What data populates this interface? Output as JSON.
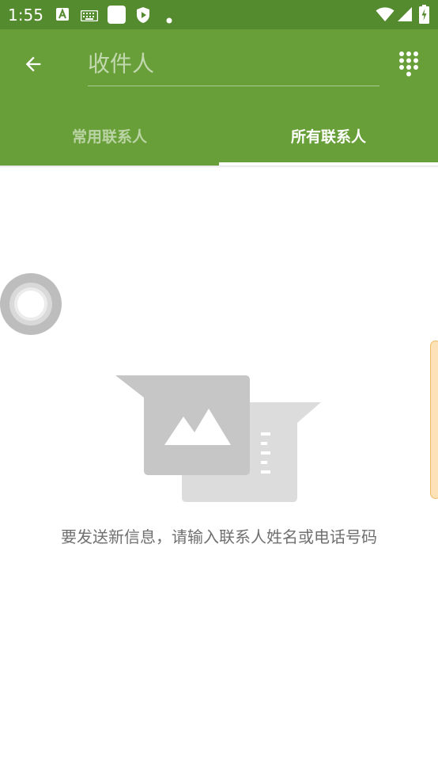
{
  "status_bar": {
    "time": "1:55",
    "icons": [
      "a-notification-icon",
      "keyboard-icon",
      "square-notification-icon",
      "shield-play-icon",
      "dot-icon",
      "wifi-icon",
      "signal-icon",
      "battery-charging-icon"
    ]
  },
  "app_bar": {
    "back_icon": "arrow-back-icon",
    "recipient_placeholder": "收件人",
    "dialpad_icon": "dialpad-icon",
    "tabs": [
      {
        "label": "常用联系人",
        "selected": false
      },
      {
        "label": "所有联系人",
        "selected": true
      }
    ]
  },
  "empty_state": {
    "illustration": "message-image-icon",
    "message": "要发送新信息，请输入联系人姓名或电话号码"
  },
  "colors": {
    "status_bar": "#558b2f",
    "app_bar": "#689f38",
    "empty_text": "#707070",
    "illustration_gray": "#c6c6c6"
  }
}
